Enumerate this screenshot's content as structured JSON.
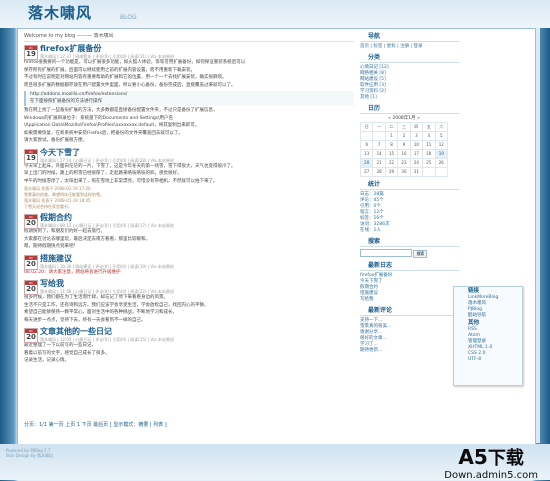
{
  "header": {
    "logo": "落木啸风",
    "logo_sub": "BLOG"
  },
  "welcome": "Welcome to my blog ——— 落木啸风",
  "posts": [
    {
      "month": "01",
      "day": "19",
      "title": "firefox扩展备份",
      "meta": "落木啸风 | 17:37 | 网络相关 | 评论(0) | 引用(0) | 阅读(31) | Via 本站原创",
      "body": [
        "firefox很重要的一个功能是，可以扩展很多功能，如火狐人体验，等等可用扩展备份，如何保证重装系统后可以",
        "保存所有扩展的扩展，后面可以继续使用之前的扩展内容设置，而不用重新下载安装。",
        "不过有时应说明是对网站内容有重要帮助的扩展和它的位置，用一个一个去找扩展安装，确实很麻烦。",
        "而且很多扩展的数据都存放在用户配置文件里面，所以要小心备份，备份完成后，直接覆盖过来就可以了。"
      ],
      "quote": [
        "http://addons.mozilla.cn/firefox/extensions/",
        "在下面按照扩展备份的方法进行操作"
      ],
      "body2": [
        "我在网上找了一些备份扩展的方法，大多数都是直接备份配置文件夹，不过只是备份了扩展信息，",
        "Windows的扩展目录位于：系统盘下的Documents and Settings\\用户名",
        "\\Application Data\\Mozilla\\Firefox\\Profiles\\xxxxxxxx.default，将其复制出来即可。",
        "如果需要恢复，在新系统中安装Firefox后，把备份的文件夹覆盖回去就可以了。",
        "请大家尝试，备份扩展很方便。"
      ]
    },
    {
      "month": "01",
      "day": "19",
      "title": "今天下雪了",
      "meta": "落木啸风 | 17:14 | 心情日记 | 评论(0) | 引用(0) | 阅读(28) | Via 本站原创",
      "body": [
        "今天早上起床，外面白茫茫的一片，下雪了。这是今年冬天的第一场雪，雪下得很大，天气也变得很冷了。",
        "早上出门的时候，路上的积雪已经很厚了，走起路来咯吱咯吱的响，感觉很好。",
        "中午的时候雪停了，太阳出来了，照在雪地上非常漂亮，可惜没有带相机，不然就可以拍下来了。"
      ],
      "notes": [
        "落木啸风 发表于 2008-01-19 17:20",
        "雪景真的很美，希望明年还能看到这样的雪。",
        "落木啸风 发表于 2008-01-19 18:05",
        "下雪天适合待在家里看书。"
      ]
    },
    {
      "month": "01",
      "day": "20",
      "title": "假期合约",
      "meta": "落木啸风 | 09:12 | 心情日记 | 评论(0) | 引用(0) | 阅读(17) | Via 本站原创",
      "body": [
        "假期快到了，和朋友们约好一起去旅行。",
        "大家都在讨论去哪里玩，最后决定去南方看看，那里比较暖和。"
      ],
      "tail": "嗯，期待假期快点到来吧！"
    },
    {
      "month": "01",
      "day": "20",
      "title": "措施建议",
      "meta": "落木啸风 | 10:30 | 网站建设 | 评论(0) | 引用(0) | 阅读(19) | Via 本站原创",
      "body": [],
      "red_line": "08.02.20：请大家注意，网站将会进行升级维护"
    },
    {
      "month": "01",
      "day": "20",
      "title": "写给我",
      "meta": "落木啸风 | 11:48 | 心情日记 | 评论(0) | 引用(0) | 阅读(22) | Via 本站原创",
      "body": [
        "很多时候，我们都在为了生活而忙碌，却忘记了停下来看看身边的风景。",
        "生活不只是工作，还有诗和远方。我们应该学会享受生活，学会放松自己，找回内心的平静。",
        "希望自己能够保持一颗平常心，面对生活中的各种挑战，不断地学习和成长。",
        "每天进步一点点，坚持下去，终有一天会看到不一样的自己。"
      ]
    },
    {
      "month": "01",
      "day": "20",
      "title": "文章其他的一些日记",
      "meta": "落木啸风 | 12:05 | 心情日记 | 评论(0) | 引用(0) | 阅读(15) | Via 本站原创",
      "body": [
        "最近整理了一下以前写的一些日记，",
        "看着以前写的文字，感觉自己成长了很多。",
        "记录生活，记录心情。"
      ]
    }
  ],
  "pager": "分页：1/1 第一页 上页 1 下页 最后页 [ 显示模式：摘要 | 列表 ]",
  "sidebar": {
    "nav_title": "导航",
    "nav_items": [
      "首页 | 标签 | 星标 | 注册 | 登录"
    ],
    "cat_title": "分类",
    "cat_items": [
      "心情日记 [12]",
      "网络相关 [8]",
      "网站建设 [5]",
      "软件应用 [3]",
      "学习资料 [2]",
      "其他 [1]"
    ],
    "cal_title": "日历",
    "cal_caption": "« 2008年1月 »",
    "cal_head": [
      "日",
      "一",
      "二",
      "三",
      "四",
      "五",
      "六"
    ],
    "cal_rows": [
      [
        "",
        "",
        "1",
        "2",
        "3",
        "4",
        "5"
      ],
      [
        "6",
        "7",
        "8",
        "9",
        "10",
        "11",
        "12"
      ],
      [
        "13",
        "14",
        "15",
        "16",
        "17",
        "18",
        "19"
      ],
      [
        "20",
        "21",
        "22",
        "23",
        "24",
        "25",
        "26"
      ],
      [
        "27",
        "28",
        "29",
        "30",
        "31",
        "",
        ""
      ]
    ],
    "stat_title": "统计",
    "stat_items": [
      "日志：28篇",
      "评论：45个",
      "引用：0个",
      "留言：12个",
      "标签：16个",
      "访问：3286次",
      "在线：1人"
    ],
    "search_title": "搜索",
    "search_placeholder": "",
    "search_button": "搜索",
    "recent_title": "最新日志",
    "recent_items": [
      "firefox扩展备份",
      "今天下雪了",
      "假期合约",
      "措施建议",
      "写给我"
    ],
    "comment_title": "最新评论",
    "comment_items": [
      "支持一下...",
      "雪景真的很美...",
      "谢谢分享...",
      "很好的文章...",
      "学习了...",
      "期待更新..."
    ]
  },
  "float_panel": {
    "link_title": "链接",
    "link_items": [
      "LinkMoreBlog",
      "落木啸风",
      "PJBlog",
      "酷站导航"
    ],
    "other_title": "其他",
    "other_items": [
      "RSS",
      "Atom",
      "管理登录",
      "XHTML 1.0",
      "CSS 2.0",
      "UTF-8"
    ]
  },
  "footer": {
    "line1": "Powered by PJBlog 2.7",
    "line2": "Skin Design by 落木啸风"
  },
  "watermark": {
    "main_a": "A5",
    "main_b": "下载",
    "sub": "Down.admin5.com"
  }
}
